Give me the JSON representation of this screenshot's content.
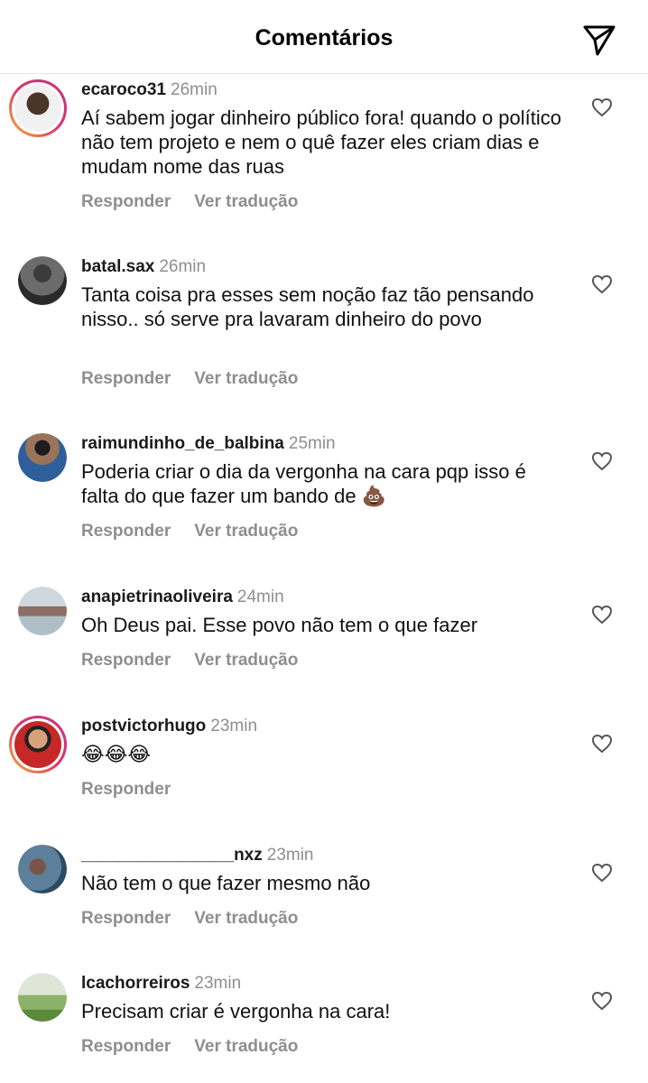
{
  "header": {
    "title": "Comentários",
    "send_icon": "paper-plane-icon"
  },
  "actions": {
    "reply": "Responder",
    "translate": "Ver tradução"
  },
  "comments": [
    {
      "user": "ecaroco31",
      "time": "26min",
      "text": "Aí sabem jogar dinheiro público fora! quando o político não tem projeto e nem o quê fazer eles criam dias e mudam nome das ruas",
      "has_story": true
    },
    {
      "user": "batal.sax",
      "time": "26min",
      "text": "Tanta coisa pra esses sem noção faz  tão pensando nisso.. só serve pra lavaram dinheiro do povo",
      "has_story": false
    },
    {
      "user": "raimundinho_de_balbina",
      "time": "25min",
      "text": "Poderia criar o dia da vergonha na cara pqp isso é falta do que fazer um bando de 💩",
      "has_story": false
    },
    {
      "user": "anapietrinaoliveira",
      "time": "24min",
      "text": "Oh Deus pai. Esse povo não tem o que fazer",
      "has_story": false
    },
    {
      "user": "postvictorhugo",
      "time": "23min",
      "text": "😂😂😂",
      "has_story": true
    },
    {
      "user": "________________nxz",
      "time": "23min",
      "text": "Não tem o que fazer mesmo não",
      "has_story": false
    },
    {
      "user": "lcachorreiros",
      "time": "23min",
      "text": "Precisam criar é  vergonha na cara!",
      "has_story": false
    }
  ]
}
